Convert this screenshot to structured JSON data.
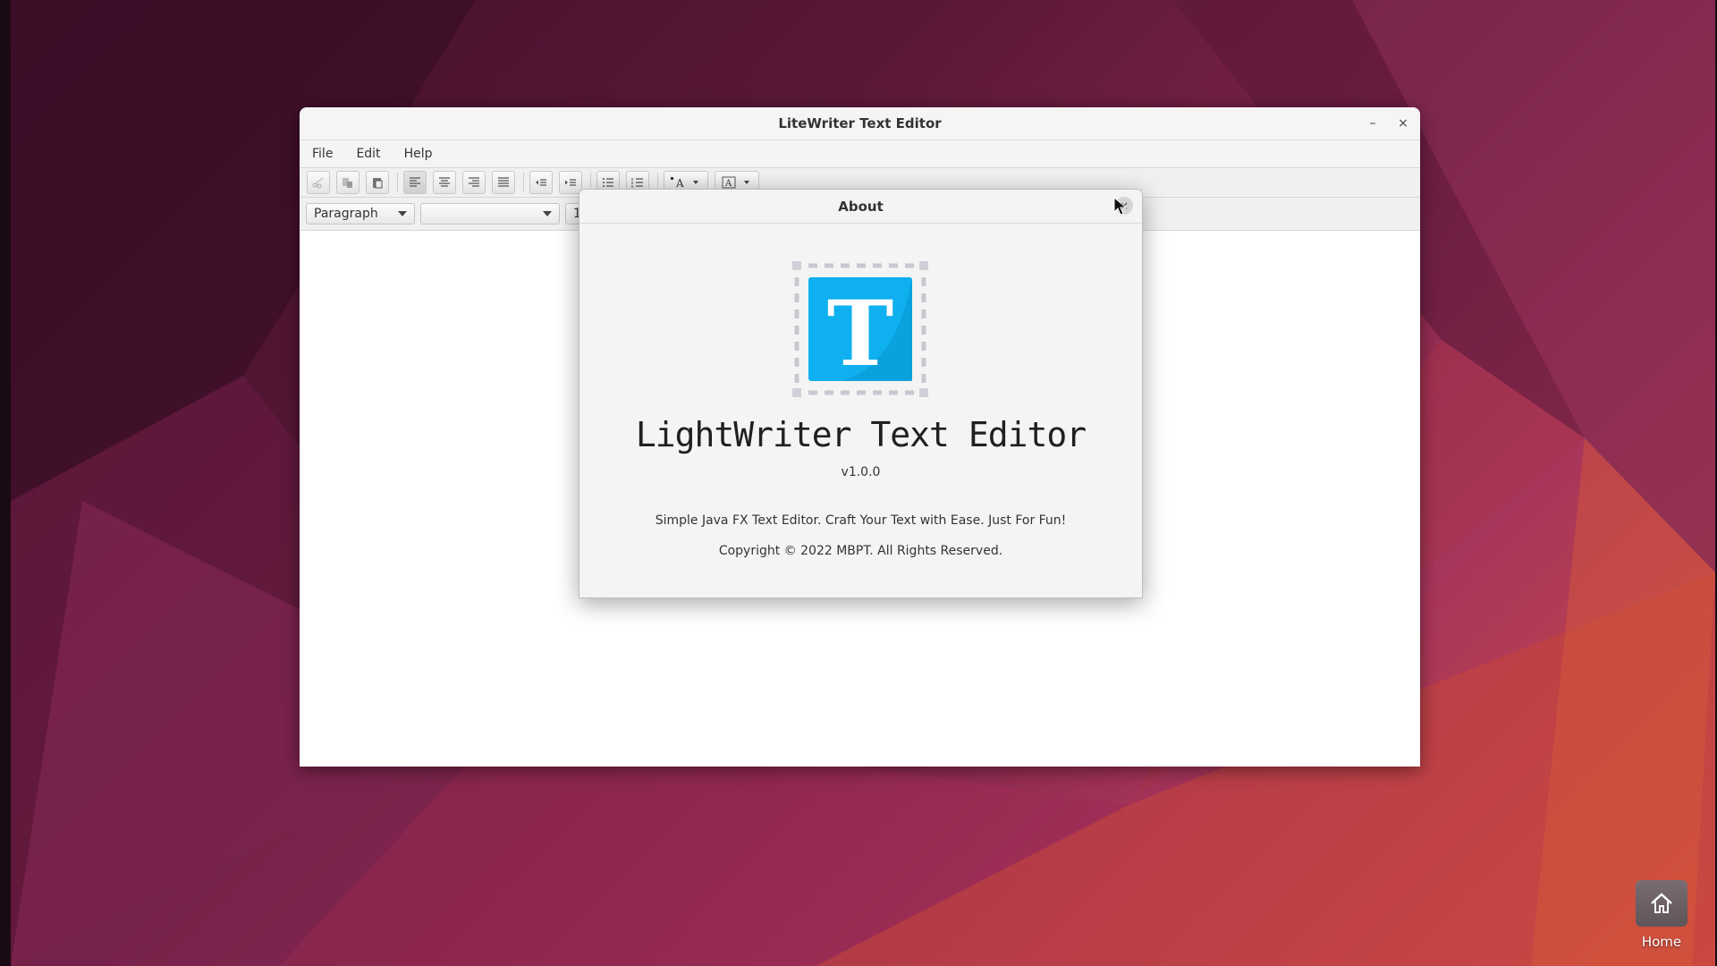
{
  "window": {
    "title": "LiteWriter Text Editor",
    "minimize_glyph": "–",
    "close_glyph": "×"
  },
  "menubar": {
    "items": [
      "File",
      "Edit",
      "Help"
    ]
  },
  "toolbar": {
    "icons": [
      "cut-icon",
      "copy-icon",
      "paste-icon",
      "align-left-icon",
      "align-center-icon",
      "align-right-icon",
      "align-justify-icon",
      "outdent-icon",
      "indent-icon",
      "bullet-list-icon",
      "numbered-list-icon",
      "text-color-icon",
      "highlight-color-icon"
    ]
  },
  "formatbar": {
    "paragraph_style": "Paragraph",
    "font_family": "",
    "font_size_partial": "1"
  },
  "about_dialog": {
    "title": "About",
    "close_glyph": "×",
    "logo_letter": "T",
    "app_name": "LightWriter Text Editor",
    "version": "v1.0.0",
    "description": "Simple Java FX Text Editor. Craft Your Text with Ease. Just For Fun!",
    "copyright": "Copyright  © 2022 MBPT. All Rights Reserved.",
    "logo_color": "#0fb0f0"
  },
  "desktop": {
    "home_label": "Home"
  }
}
